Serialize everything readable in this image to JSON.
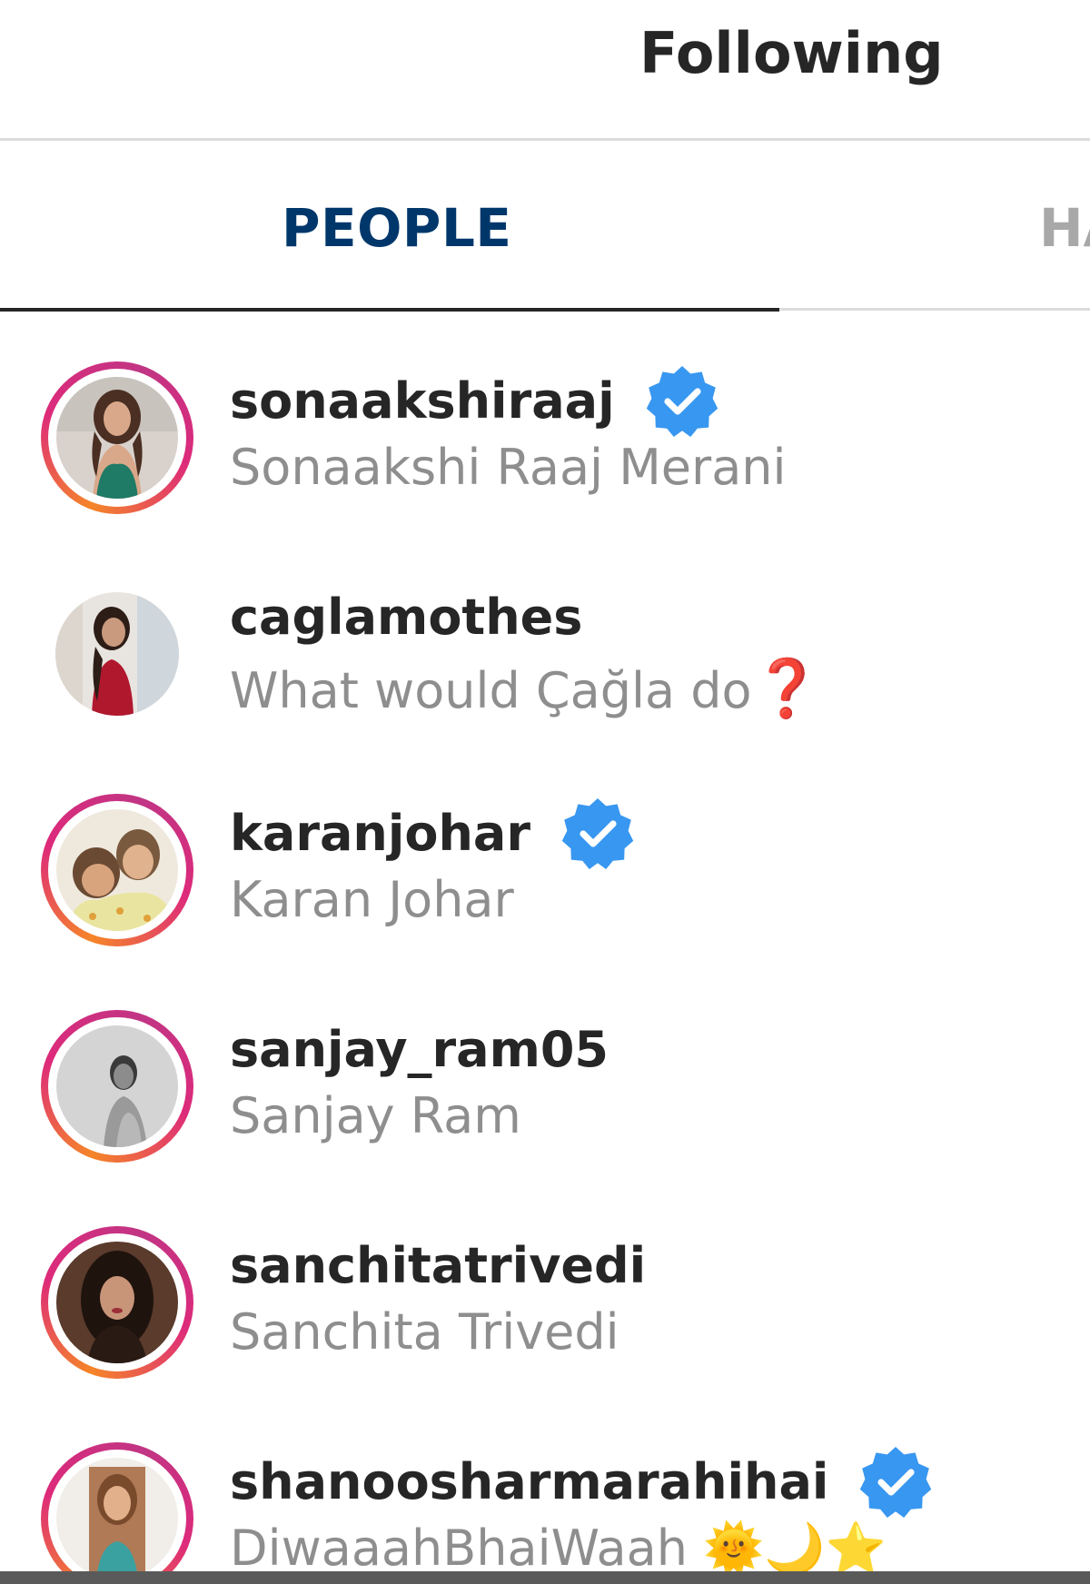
{
  "header": {
    "title": "Following"
  },
  "tabs": [
    {
      "label": "PEOPLE",
      "active": true
    },
    {
      "label": "HA",
      "active": false
    }
  ],
  "following": [
    {
      "username": "sonaakshiraaj",
      "full_name": "Sonaakshi Raaj Merani",
      "verified": true,
      "has_story": true
    },
    {
      "username": "caglamothes",
      "full_name": "What would Çağla do",
      "full_name_emoji": "❓",
      "verified": false,
      "has_story": false
    },
    {
      "username": "karanjohar",
      "full_name": "Karan Johar",
      "verified": true,
      "has_story": true
    },
    {
      "username": "sanjay_ram05",
      "full_name": "Sanjay Ram",
      "verified": false,
      "has_story": true
    },
    {
      "username": "sanchitatrivedi",
      "full_name": "Sanchita Trivedi",
      "verified": false,
      "has_story": true
    },
    {
      "username": "shanoosharmarahihai",
      "full_name": "DiwaaahBhaiWaah 🌞🌙⭐",
      "verified": true,
      "has_story": true
    }
  ],
  "colors": {
    "verified_badge": "#3897f0",
    "active_tab_text": "#00376b",
    "story_ring_start": "#f58529",
    "story_ring_end": "#dd2a7b"
  }
}
